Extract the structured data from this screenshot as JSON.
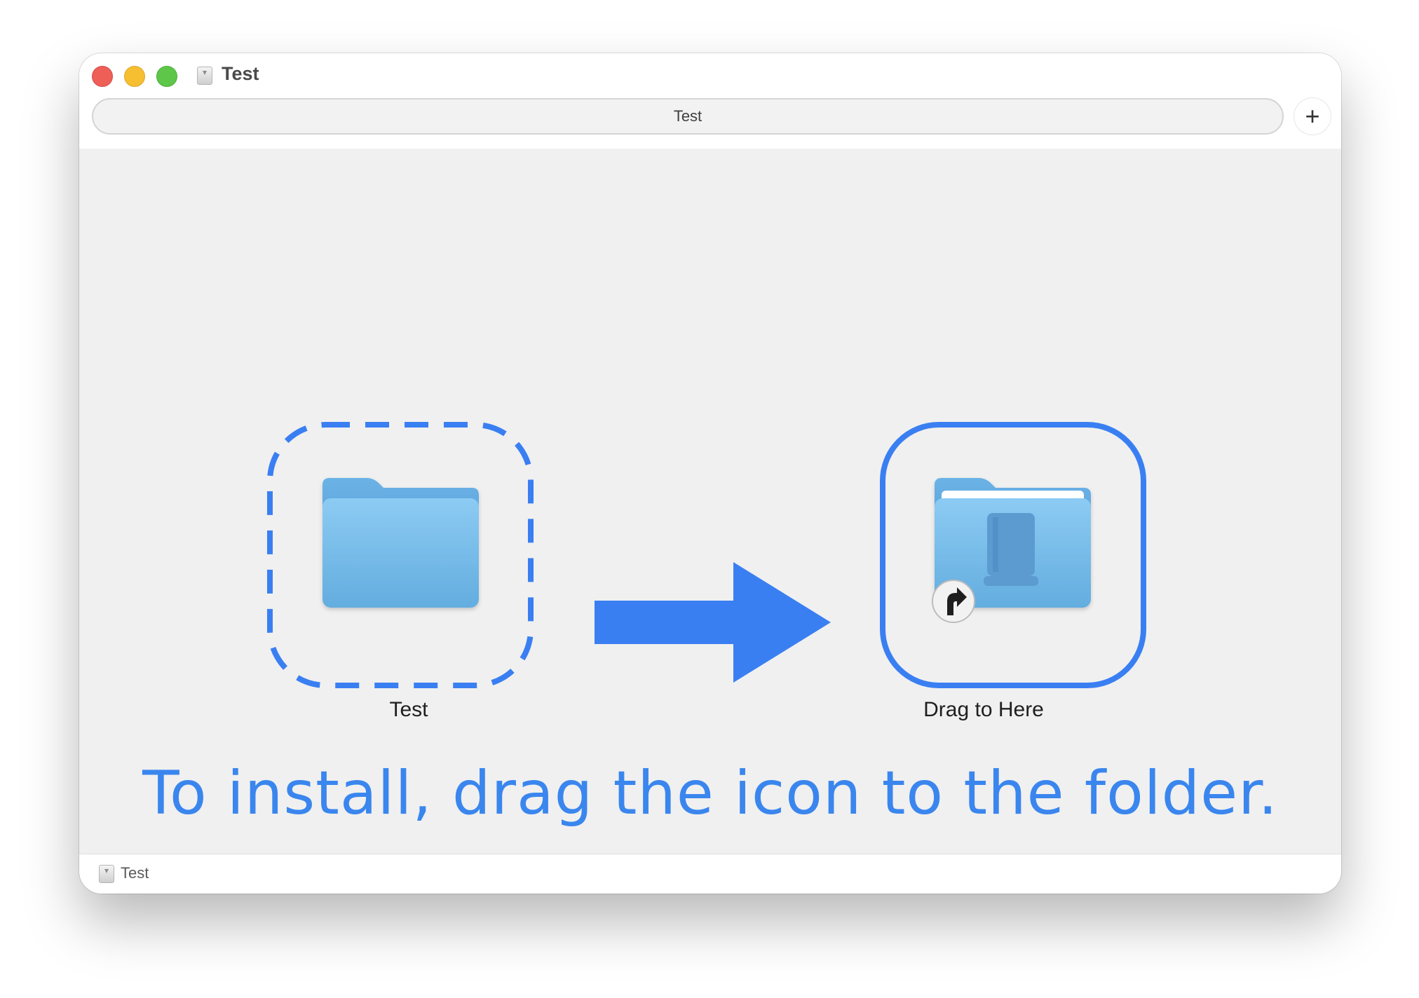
{
  "window": {
    "title": "Test",
    "tab_label": "Test",
    "new_tab_label": "+"
  },
  "content": {
    "source_label": "Test",
    "target_label": "Drag to Here",
    "instruction": "To install, drag the icon to the folder."
  },
  "statusbar": {
    "path_label": "Test"
  },
  "icons": {
    "source": "folder-icon",
    "target": "applications-folder-alias-icon",
    "arrow": "arrow-right-icon",
    "alias": "alias-arrow-icon",
    "disk": "disk-image-icon"
  },
  "colors": {
    "accent_blue": "#3a7ff2",
    "folder_blue": "#78bff0",
    "close": "#ee5f58",
    "minimize": "#f6bf31",
    "zoom": "#5ec649"
  }
}
